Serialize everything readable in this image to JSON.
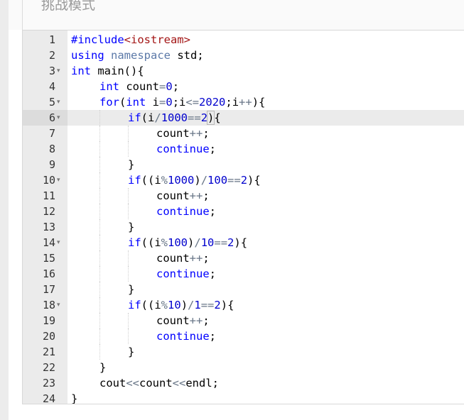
{
  "header": {
    "title": "挑战模式"
  },
  "editor": {
    "active_line": 6,
    "lines": [
      {
        "n": "1",
        "fold": false,
        "indent": 0,
        "tokens": [
          {
            "t": "#include",
            "c": "kw"
          },
          {
            "t": "<iostream>",
            "c": "str"
          }
        ]
      },
      {
        "n": "2",
        "fold": false,
        "indent": 0,
        "tokens": [
          {
            "t": "using",
            "c": "kw"
          },
          {
            "t": " ",
            "c": ""
          },
          {
            "t": "namespace",
            "c": "ns"
          },
          {
            "t": " std;",
            "c": ""
          }
        ]
      },
      {
        "n": "3",
        "fold": true,
        "indent": 0,
        "tokens": [
          {
            "t": "int",
            "c": "kw"
          },
          {
            "t": " main(){",
            "c": ""
          }
        ]
      },
      {
        "n": "4",
        "fold": false,
        "indent": 1,
        "tokens": [
          {
            "t": "int",
            "c": "kw"
          },
          {
            "t": " count",
            "c": ""
          },
          {
            "t": "=",
            "c": "op"
          },
          {
            "t": "0",
            "c": "num"
          },
          {
            "t": ";",
            "c": ""
          }
        ]
      },
      {
        "n": "5",
        "fold": true,
        "indent": 1,
        "tokens": [
          {
            "t": "for",
            "c": "kw"
          },
          {
            "t": "(",
            "c": ""
          },
          {
            "t": "int",
            "c": "kw"
          },
          {
            "t": " i",
            "c": ""
          },
          {
            "t": "=",
            "c": "op"
          },
          {
            "t": "0",
            "c": "num"
          },
          {
            "t": ";i",
            "c": ""
          },
          {
            "t": "<=",
            "c": "op"
          },
          {
            "t": "2020",
            "c": "num"
          },
          {
            "t": ";i",
            "c": ""
          },
          {
            "t": "++",
            "c": "op"
          },
          {
            "t": "){",
            "c": ""
          }
        ]
      },
      {
        "n": "6",
        "fold": true,
        "indent": 2,
        "tokens": [
          {
            "t": "if",
            "c": "kw"
          },
          {
            "t": "(i",
            "c": ""
          },
          {
            "t": "/",
            "c": "op"
          },
          {
            "t": "1000",
            "c": "num"
          },
          {
            "t": "==",
            "c": "op"
          },
          {
            "t": "2",
            "c": "num"
          },
          {
            "t": ")",
            "c": "bracket"
          },
          {
            "t": "{",
            "c": ""
          }
        ]
      },
      {
        "n": "7",
        "fold": false,
        "indent": 3,
        "tokens": [
          {
            "t": "count",
            "c": ""
          },
          {
            "t": "++",
            "c": "op"
          },
          {
            "t": ";",
            "c": ""
          }
        ]
      },
      {
        "n": "8",
        "fold": false,
        "indent": 3,
        "tokens": [
          {
            "t": "continue",
            "c": "kw"
          },
          {
            "t": ";",
            "c": ""
          }
        ]
      },
      {
        "n": "9",
        "fold": false,
        "indent": 2,
        "tokens": [
          {
            "t": "}",
            "c": ""
          }
        ]
      },
      {
        "n": "10",
        "fold": true,
        "indent": 2,
        "tokens": [
          {
            "t": "if",
            "c": "kw"
          },
          {
            "t": "((i",
            "c": ""
          },
          {
            "t": "%",
            "c": "op"
          },
          {
            "t": "1000",
            "c": "num"
          },
          {
            "t": ")",
            "c": ""
          },
          {
            "t": "/",
            "c": "op"
          },
          {
            "t": "100",
            "c": "num"
          },
          {
            "t": "==",
            "c": "op"
          },
          {
            "t": "2",
            "c": "num"
          },
          {
            "t": "){",
            "c": ""
          }
        ]
      },
      {
        "n": "11",
        "fold": false,
        "indent": 3,
        "tokens": [
          {
            "t": "count",
            "c": ""
          },
          {
            "t": "++",
            "c": "op"
          },
          {
            "t": ";",
            "c": ""
          }
        ]
      },
      {
        "n": "12",
        "fold": false,
        "indent": 3,
        "tokens": [
          {
            "t": "continue",
            "c": "kw"
          },
          {
            "t": ";",
            "c": ""
          }
        ]
      },
      {
        "n": "13",
        "fold": false,
        "indent": 2,
        "tokens": [
          {
            "t": "}",
            "c": ""
          }
        ]
      },
      {
        "n": "14",
        "fold": true,
        "indent": 2,
        "tokens": [
          {
            "t": "if",
            "c": "kw"
          },
          {
            "t": "((i",
            "c": ""
          },
          {
            "t": "%",
            "c": "op"
          },
          {
            "t": "100",
            "c": "num"
          },
          {
            "t": ")",
            "c": ""
          },
          {
            "t": "/",
            "c": "op"
          },
          {
            "t": "10",
            "c": "num"
          },
          {
            "t": "==",
            "c": "op"
          },
          {
            "t": "2",
            "c": "num"
          },
          {
            "t": "){",
            "c": ""
          }
        ]
      },
      {
        "n": "15",
        "fold": false,
        "indent": 3,
        "tokens": [
          {
            "t": "count",
            "c": ""
          },
          {
            "t": "++",
            "c": "op"
          },
          {
            "t": ";",
            "c": ""
          }
        ]
      },
      {
        "n": "16",
        "fold": false,
        "indent": 3,
        "tokens": [
          {
            "t": "continue",
            "c": "kw"
          },
          {
            "t": ";",
            "c": ""
          }
        ]
      },
      {
        "n": "17",
        "fold": false,
        "indent": 2,
        "tokens": [
          {
            "t": "}",
            "c": ""
          }
        ]
      },
      {
        "n": "18",
        "fold": true,
        "indent": 2,
        "tokens": [
          {
            "t": "if",
            "c": "kw"
          },
          {
            "t": "((i",
            "c": ""
          },
          {
            "t": "%",
            "c": "op"
          },
          {
            "t": "10",
            "c": "num"
          },
          {
            "t": ")",
            "c": ""
          },
          {
            "t": "/",
            "c": "op"
          },
          {
            "t": "1",
            "c": "num"
          },
          {
            "t": "==",
            "c": "op"
          },
          {
            "t": "2",
            "c": "num"
          },
          {
            "t": "){",
            "c": ""
          }
        ]
      },
      {
        "n": "19",
        "fold": false,
        "indent": 3,
        "tokens": [
          {
            "t": "count",
            "c": ""
          },
          {
            "t": "++",
            "c": "op"
          },
          {
            "t": ";",
            "c": ""
          }
        ]
      },
      {
        "n": "20",
        "fold": false,
        "indent": 3,
        "tokens": [
          {
            "t": "continue",
            "c": "kw"
          },
          {
            "t": ";",
            "c": ""
          }
        ]
      },
      {
        "n": "21",
        "fold": false,
        "indent": 2,
        "tokens": [
          {
            "t": "}",
            "c": ""
          }
        ]
      },
      {
        "n": "22",
        "fold": false,
        "indent": 1,
        "tokens": [
          {
            "t": "}",
            "c": ""
          }
        ]
      },
      {
        "n": "23",
        "fold": false,
        "indent": 1,
        "tokens": [
          {
            "t": "cout",
            "c": ""
          },
          {
            "t": "<<",
            "c": "op"
          },
          {
            "t": "count",
            "c": ""
          },
          {
            "t": "<<",
            "c": "op"
          },
          {
            "t": "endl;",
            "c": ""
          }
        ]
      },
      {
        "n": "24",
        "fold": false,
        "indent": 0,
        "tokens": [
          {
            "t": "}",
            "c": ""
          }
        ]
      }
    ]
  }
}
